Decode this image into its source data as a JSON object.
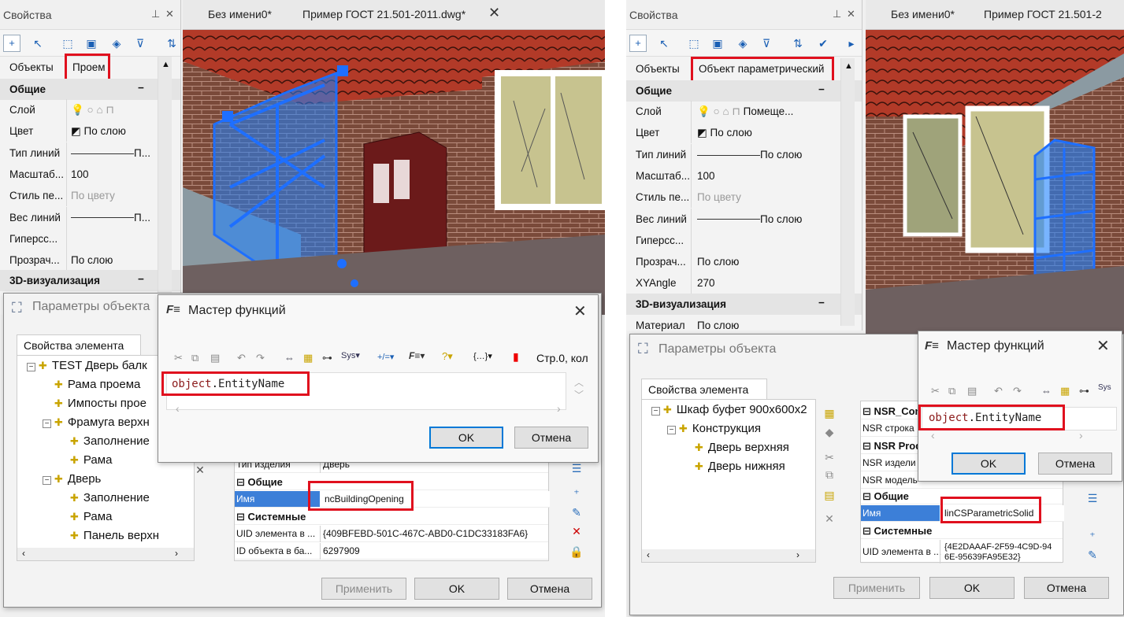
{
  "left": {
    "props": {
      "title": "Свойства",
      "objects_label": "Объекты",
      "objects_value": "Проем",
      "section_general": "Общие",
      "rows": [
        {
          "k": "Слой",
          "v": ""
        },
        {
          "k": "Цвет",
          "v": "По слою"
        },
        {
          "k": "Тип линий",
          "v": "П..."
        },
        {
          "k": "Масштаб...",
          "v": "100"
        },
        {
          "k": "Стиль пе...",
          "v": "По цвету"
        },
        {
          "k": "Вес линий",
          "v": "П..."
        },
        {
          "k": "Гиперсс...",
          "v": ""
        },
        {
          "k": "Прозрач...",
          "v": "По слою"
        }
      ],
      "section_3d": "3D-визуализация"
    },
    "tabs": [
      "Без имени0*",
      "Пример ГОСТ 21.501-2011.dwg*"
    ],
    "params": {
      "title": "Параметры объекта",
      "tab": "Свойства элемента",
      "tree": [
        {
          "label": "TEST Дверь балк",
          "level": 0,
          "exp": "−"
        },
        {
          "label": "Рама проема",
          "level": 1
        },
        {
          "label": "Импосты прое",
          "level": 1
        },
        {
          "label": "Фрамуга верхн",
          "level": 1,
          "exp": "−"
        },
        {
          "label": "Заполнение",
          "level": 2
        },
        {
          "label": "Рама",
          "level": 2
        },
        {
          "label": "Дверь",
          "level": 1,
          "exp": "−"
        },
        {
          "label": "Заполнение",
          "level": 2
        },
        {
          "label": "Рама",
          "level": 2
        },
        {
          "label": "Панель верхн",
          "level": 2
        }
      ],
      "grid_first": {
        "k": "Тип изделия",
        "v": "Дверь"
      },
      "sec_general": "Общие",
      "name_key": "Имя",
      "name_value": "ncBuildingOpening",
      "sec_system": "Системные",
      "uid_key": "UID элемента в ...",
      "uid_value": "{409BFEBD-501C-467C-ABD0-C1DC33183FA6}",
      "id_key": "ID объекта в ба...",
      "id_value": "6297909",
      "apply": "Применить",
      "ok": "OK",
      "cancel": "Отмена"
    },
    "wizard": {
      "title": "Мастер функций",
      "code_obj": "object",
      "code_prop": "EntityName",
      "toolbar_right": "Стр.0, кол",
      "ok": "OK",
      "cancel": "Отмена"
    }
  },
  "right": {
    "props": {
      "title": "Свойства",
      "objects_label": "Объекты",
      "objects_value": "Объект параметрический",
      "section_general": "Общие",
      "rows": [
        {
          "k": "Слой",
          "v": "Помеще..."
        },
        {
          "k": "Цвет",
          "v": "По слою"
        },
        {
          "k": "Тип линий",
          "v": "По слою"
        },
        {
          "k": "Масштаб...",
          "v": "100"
        },
        {
          "k": "Стиль пе...",
          "v": "По цвету"
        },
        {
          "k": "Вес линий",
          "v": "По слою"
        },
        {
          "k": "Гиперсс...",
          "v": ""
        },
        {
          "k": "Прозрач...",
          "v": "По слою"
        },
        {
          "k": "XYAngle",
          "v": "270"
        }
      ],
      "section_3d": "3D-визуализация",
      "material_key": "Материал",
      "material_value": "По слою"
    },
    "tabs": [
      "Без имени0*",
      "Пример ГОСТ 21.501-2"
    ],
    "params": {
      "title": "Параметры объекта",
      "tab": "Свойства элемента",
      "tree": [
        {
          "label": "Шкаф буфет 900х600х2",
          "level": 0,
          "exp": "−"
        },
        {
          "label": "Конструкция",
          "level": 1,
          "exp": "−"
        },
        {
          "label": "Дверь верхняя",
          "level": 2
        },
        {
          "label": "Дверь нижняя",
          "level": 2
        }
      ],
      "sec_nsr_comm": "NSR_Comm",
      "nsr_row": "NSR строка",
      "sec_nsr_prod": "NSR Produ",
      "nsr_izd": "NSR издели",
      "nsr_model": "NSR модель",
      "sec_general": "Общие",
      "name_key": "Имя",
      "name_value": "linCSParametricSolid",
      "sec_system": "Системные",
      "uid_key": "UID элемента в ...",
      "uid_value": "{4E2DAAAF-2F59-4C9D-94 6E-95639FA95E32}",
      "apply": "Применить",
      "ok": "OK",
      "cancel": "Отмена"
    },
    "wizard": {
      "title": "Мастер функций",
      "code_obj": "object",
      "code_prop": "EntityName",
      "ok": "OK",
      "cancel": "Отмена"
    }
  }
}
